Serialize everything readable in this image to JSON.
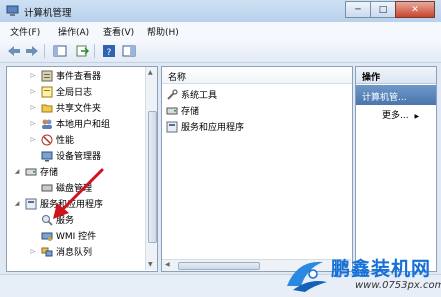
{
  "window": {
    "title": "计算机管理"
  },
  "menu": [
    "文件(F)",
    "操作(A)",
    "查看(V)",
    "帮助(H)"
  ],
  "tree": [
    {
      "label": "事件查看器",
      "icon": "event-viewer-icon"
    },
    {
      "label": "全局日志",
      "icon": "log-icon"
    },
    {
      "label": "共享文件夹",
      "icon": "shared-folder-icon"
    },
    {
      "label": "本地用户和组",
      "icon": "users-icon"
    },
    {
      "label": "性能",
      "icon": "performance-icon"
    },
    {
      "label": "设备管理器",
      "icon": "device-manager-icon"
    },
    {
      "label": "存储",
      "icon": "storage-icon"
    },
    {
      "label": "磁盘管理",
      "icon": "disk-icon"
    },
    {
      "label": "服务和应用程序",
      "icon": "services-apps-icon"
    },
    {
      "label": "服务",
      "icon": "services-icon"
    },
    {
      "label": "WMI 控件",
      "icon": "wmi-icon"
    },
    {
      "label": "消息队列",
      "icon": "message-queue-icon"
    }
  ],
  "list": {
    "header": "名称",
    "items": [
      {
        "label": "系统工具",
        "icon": "tools-icon"
      },
      {
        "label": "存储",
        "icon": "storage-icon"
      },
      {
        "label": "服务和应用程序",
        "icon": "services-apps-icon"
      }
    ]
  },
  "actions": {
    "header": "操作",
    "section": "计算机管...",
    "more": "更多..."
  },
  "watermark": {
    "name": "鹏鑫装机网",
    "url": "www.0753px.com"
  }
}
